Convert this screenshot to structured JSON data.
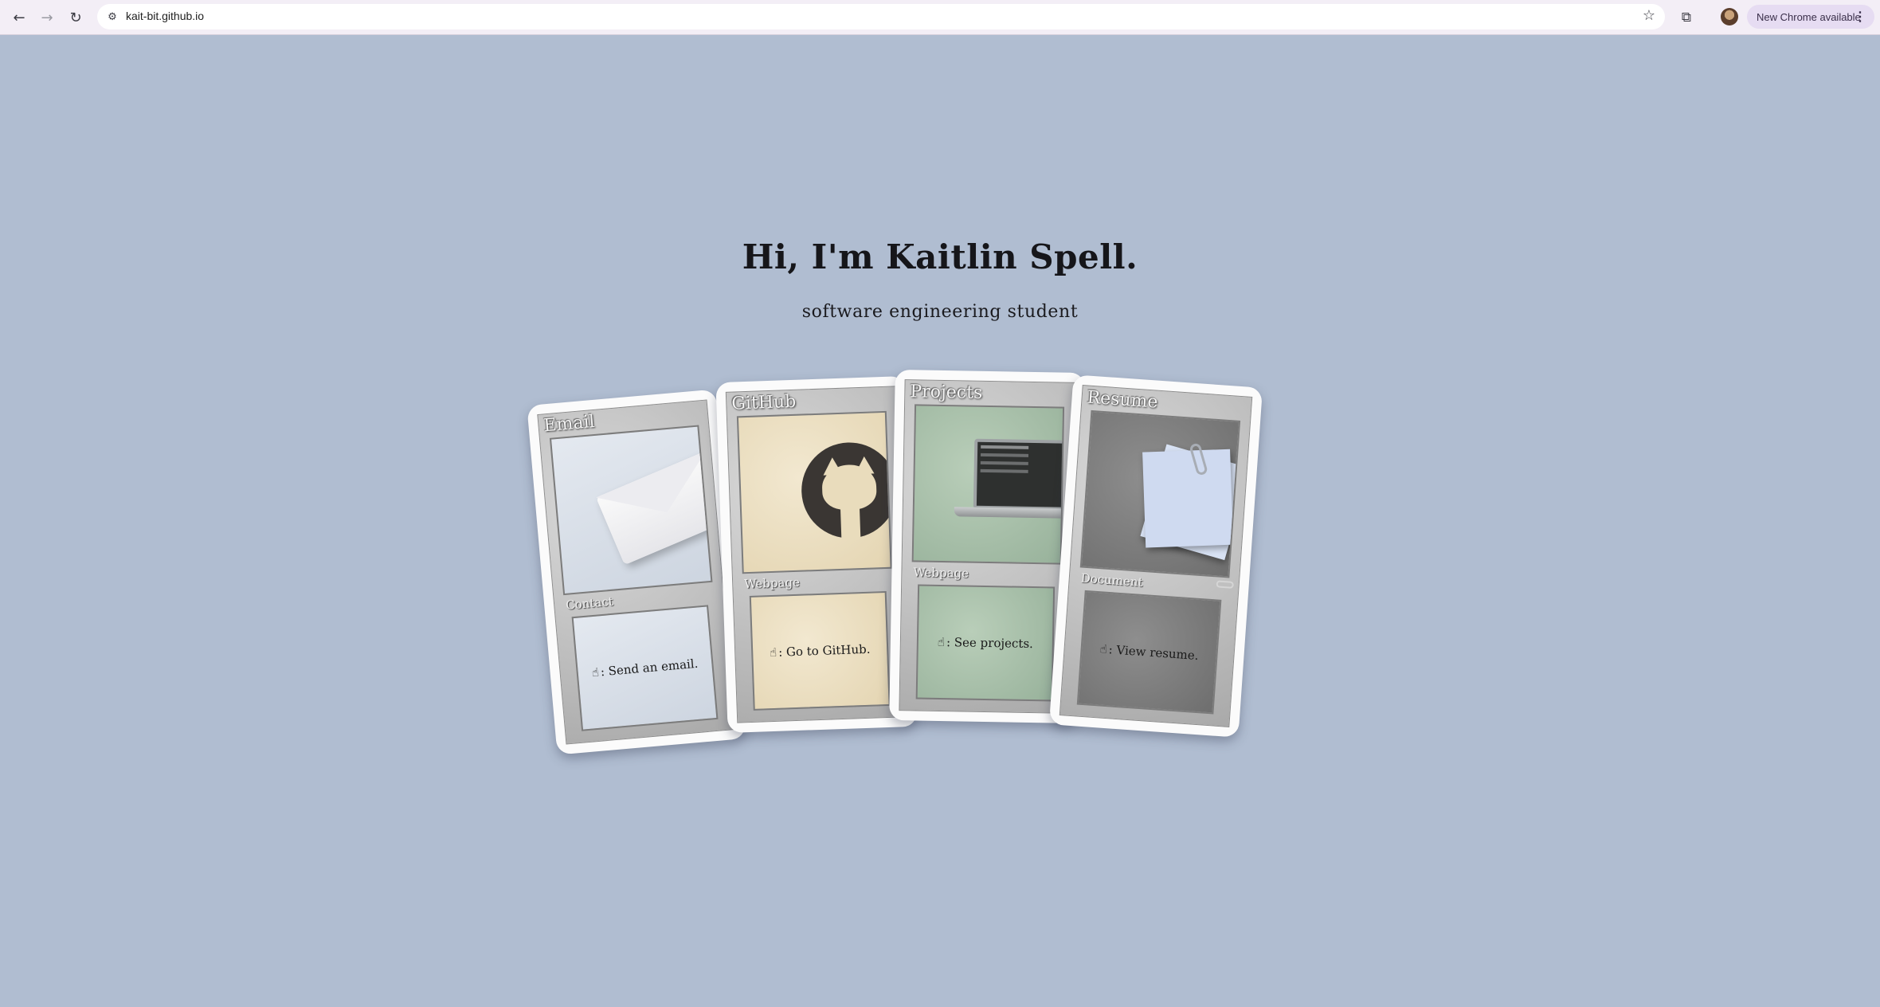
{
  "browser": {
    "url": "kait-bit.github.io",
    "update_label": "New Chrome available",
    "icons": [
      "back-arrow-icon",
      "forward-arrow-icon",
      "reload-icon",
      "site-settings-icon",
      "bookmark-star-icon",
      "extensions-icon",
      "profile-avatar",
      "more-menu-icon"
    ]
  },
  "hero": {
    "title": "Hi, I'm Kaitlin Spell.",
    "subtitle": "software engineering student"
  },
  "cards": {
    "email": {
      "title": "Email",
      "type": "Contact",
      "action": ": Send an email."
    },
    "github": {
      "title": "GitHub",
      "type": "Webpage",
      "action": ": Go to GitHub."
    },
    "projects": {
      "title": "Projects",
      "type": "Webpage",
      "action": ": See projects."
    },
    "resume": {
      "title": "Resume",
      "type": "Document",
      "action": ": View resume."
    }
  },
  "colors": {
    "page_background": "#b0bdd1",
    "email_card": "#d6dde8",
    "github_card": "#ebdfc2",
    "projects_card": "#a9c1aa",
    "resume_card": "#7e7e7e"
  }
}
